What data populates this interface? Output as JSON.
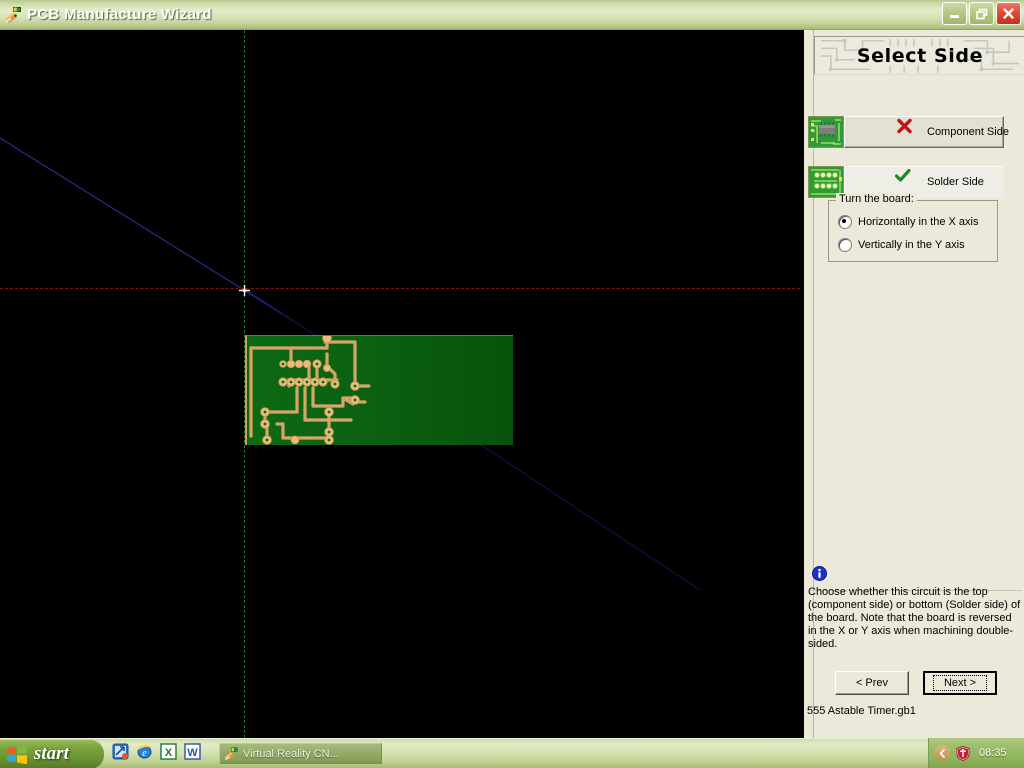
{
  "window": {
    "title": "PCB Manufacture Wizard",
    "icon": "pcb-wizard-icon",
    "buttons": {
      "minimize": "minimize-icon",
      "restore": "restore-icon",
      "close": "close-icon"
    }
  },
  "canvas": {
    "name": "pcb-design-canvas",
    "origin_marker": "origin-crosshair",
    "guides": {
      "vertical_color": "#1d7a20",
      "horizontal_color": "#8a1111",
      "diagonal_color": "#2b2b8c"
    },
    "board": {
      "name": "pcb-board-preview",
      "substrate_color": "#0b5e11",
      "trace_color": "#d6a463"
    }
  },
  "panel": {
    "header_title": "Select Side",
    "sides": [
      {
        "label": "Component Side",
        "glyph": "cross-mark-icon",
        "glyph_color": "#cc1111",
        "state": "raised",
        "thumb": "component-side-thumbnail"
      },
      {
        "label": "Solder Side",
        "glyph": "check-mark-icon",
        "glyph_color": "#1b8a1b",
        "state": "selected",
        "thumb": "solder-side-thumbnail"
      }
    ],
    "turn_group": {
      "legend": "Turn the board:",
      "options": [
        {
          "label": "Horizontally in the X axis",
          "checked": true
        },
        {
          "label": "Vertically in the Y axis",
          "checked": false
        }
      ]
    },
    "info": {
      "icon": "info-icon",
      "text": "Choose whether this circuit is the top (component side) or bottom (Solder side) of the board. Note that the board is reversed in the X or Y axis when machining double-sided."
    },
    "nav": {
      "prev_label": "< Prev",
      "next_label": "Next >"
    },
    "filename": "555 Astable Timer.gb1",
    "progress_value": 0
  },
  "taskbar": {
    "start_label": "start",
    "quicklaunch": [
      "show-desktop-icon",
      "internet-explorer-icon",
      "excel-icon",
      "word-icon"
    ],
    "tasks": [
      {
        "label": "Virtual Reality CN...",
        "icon": "pcb-wizard-icon",
        "active": true
      }
    ],
    "tray": {
      "expand_icon": "chevron-left-icon",
      "shield_icon": "security-shield-icon",
      "clock": "08:35"
    }
  }
}
